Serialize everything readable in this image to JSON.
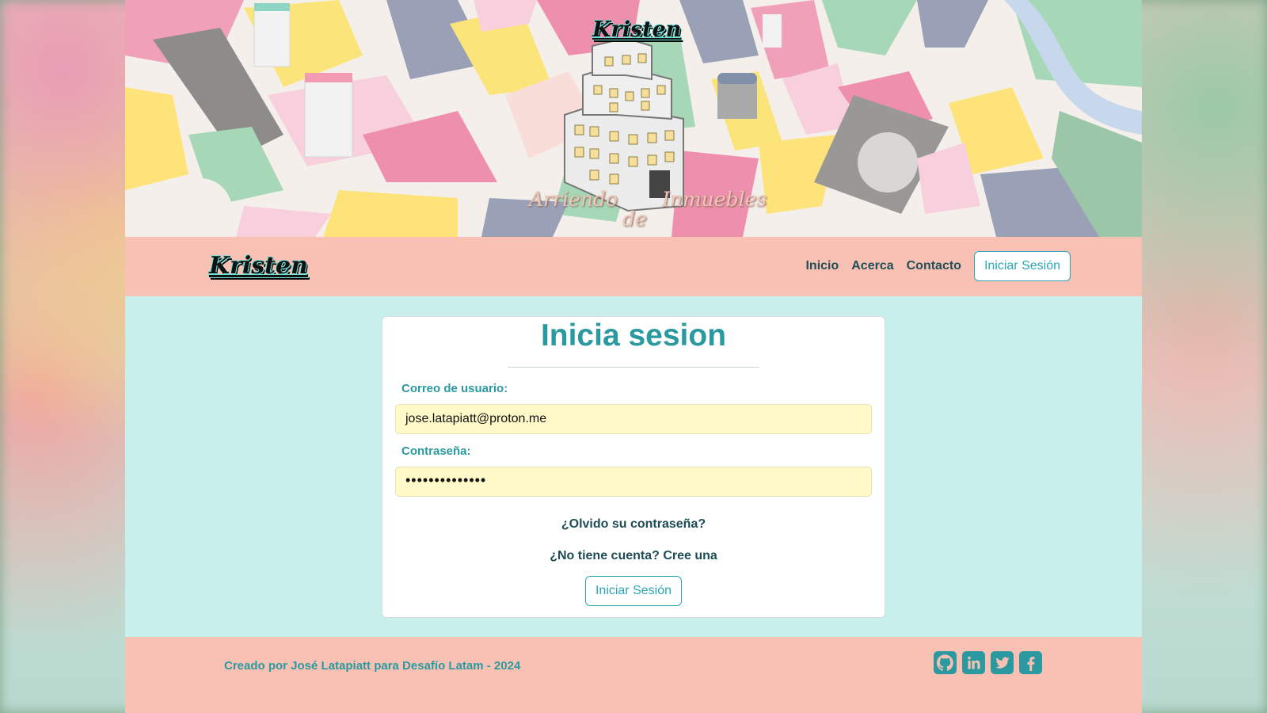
{
  "hero": {
    "brand": "Kristen",
    "tagline_words": [
      "Arriendo",
      "de",
      "Inmuebles"
    ]
  },
  "navbar": {
    "brand": "Kristen",
    "links": [
      "Inicio",
      "Acerca",
      "Contacto"
    ],
    "login_button": "Iniciar Sesión"
  },
  "login": {
    "title": "Inicia sesion",
    "email_label": "Correo de usuario:",
    "email_value": "jose.latapiatt@proton.me",
    "password_label": "Contraseña:",
    "password_value": "••••••••••••••",
    "forgot_link": "¿Olvido su contraseña?",
    "signup_link": "¿No tiene cuenta? Cree una",
    "submit_button": "Iniciar Sesión"
  },
  "footer": {
    "credit": "Creado por José Latapiatt para Desafío Latam - 2024",
    "social_icons": [
      "github-icon",
      "linkedin-icon",
      "twitter-icon",
      "facebook-icon"
    ]
  },
  "colors": {
    "accent": "#2a9aa0",
    "navbar_bg": "#f9c1b3",
    "page_bg": "#c8efec",
    "input_bg": "#fffac8"
  }
}
